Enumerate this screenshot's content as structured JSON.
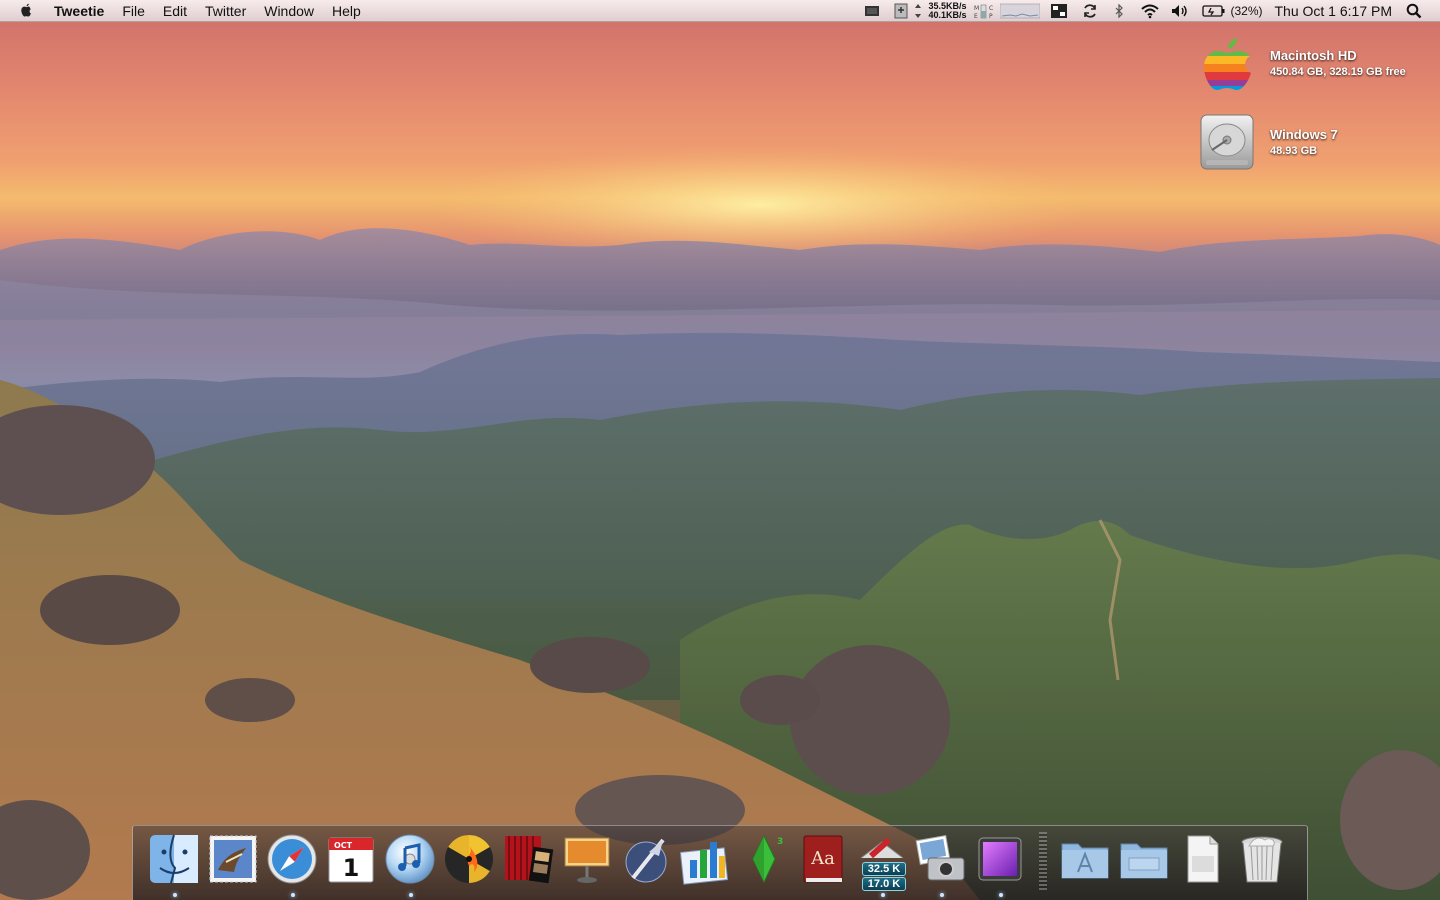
{
  "menubar": {
    "app_name": "Tweetie",
    "menus": [
      "File",
      "Edit",
      "Twitter",
      "Window",
      "Help"
    ],
    "net_up": "35.5KB/s",
    "net_down": "40.1KB/s",
    "battery": "(32%)",
    "clock": "Thu Oct 1  6:17 PM"
  },
  "desktop": {
    "drives": [
      {
        "name": "Macintosh HD",
        "info": "450.84 GB, 328.19 GB free"
      },
      {
        "name": "Windows 7",
        "info": "48.93 GB"
      }
    ]
  },
  "dock": {
    "items": [
      {
        "id": "finder",
        "running": true
      },
      {
        "id": "mail",
        "running": false
      },
      {
        "id": "safari",
        "running": true
      },
      {
        "id": "ical",
        "running": false,
        "month": "OCT",
        "day": "1"
      },
      {
        "id": "itunes",
        "running": true
      },
      {
        "id": "burn",
        "running": false
      },
      {
        "id": "front-row",
        "running": false
      },
      {
        "id": "keynote",
        "running": false
      },
      {
        "id": "quill-app",
        "running": false
      },
      {
        "id": "numbers",
        "running": false
      },
      {
        "id": "sims3",
        "running": false
      },
      {
        "id": "dictionary",
        "running": false
      },
      {
        "id": "network-monitor",
        "running": true,
        "upload": "32.5 K",
        "download": "17.0 K"
      },
      {
        "id": "iphoto",
        "running": true
      },
      {
        "id": "purple-app",
        "running": true
      },
      {
        "id": "applications-folder",
        "running": false
      },
      {
        "id": "documents-folder",
        "running": false
      },
      {
        "id": "downloads-stack",
        "running": false
      },
      {
        "id": "trash",
        "running": false
      }
    ]
  }
}
